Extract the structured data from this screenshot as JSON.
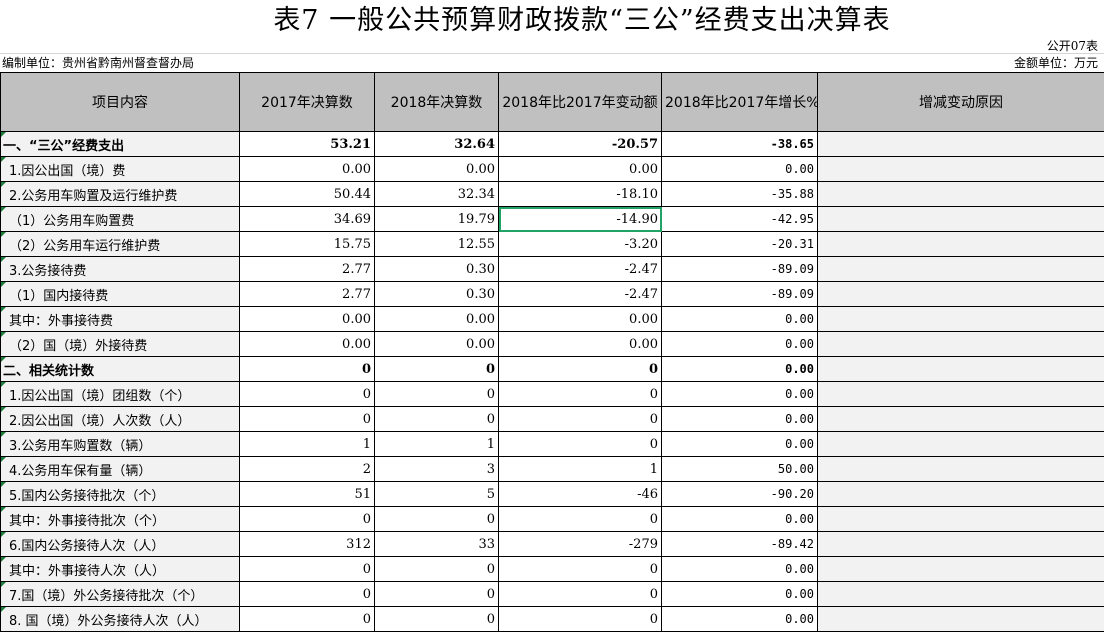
{
  "title": "表7  一般公共预算财政拨款“三公”经费支出决算表",
  "code": "公开07表",
  "unit_left": "编制单位：贵州省黔南州督查督办局",
  "unit_right": "金额单位：万元",
  "headers": [
    "项目内容",
    "2017年决算数",
    "2018年决算数",
    "2018年比2017年变动额",
    "2018年比2017年增长%",
    "增减变动原因"
  ],
  "rows": [
    {
      "name": "一、“三公”经费支出",
      "v2017": "53.21",
      "v2018": "32.64",
      "change": "-20.57",
      "pct": "-38.65",
      "reason": ""
    },
    {
      "name": "1.因公出国（境）费",
      "v2017": "0.00",
      "v2018": "0.00",
      "change": "0.00",
      "pct": "0.00",
      "reason": ""
    },
    {
      "name": "2.公务用车购置及运行维护费",
      "v2017": "50.44",
      "v2018": "32.34",
      "change": "-18.10",
      "pct": "-35.88",
      "reason": ""
    },
    {
      "name": "（1）公务用车购置费",
      "v2017": "34.69",
      "v2018": "19.79",
      "change": "-14.90",
      "pct": "-42.95",
      "reason": ""
    },
    {
      "name": "（2）公务用车运行维护费",
      "v2017": "15.75",
      "v2018": "12.55",
      "change": "-3.20",
      "pct": "-20.31",
      "reason": ""
    },
    {
      "name": "3.公务接待费",
      "v2017": "2.77",
      "v2018": "0.30",
      "change": "-2.47",
      "pct": "-89.09",
      "reason": ""
    },
    {
      "name": "（1）国内接待费",
      "v2017": "2.77",
      "v2018": "0.30",
      "change": "-2.47",
      "pct": "-89.09",
      "reason": ""
    },
    {
      "name": "其中：外事接待费",
      "v2017": "0.00",
      "v2018": "0.00",
      "change": "0.00",
      "pct": "0.00",
      "reason": ""
    },
    {
      "name": "（2）国（境）外接待费",
      "v2017": "0.00",
      "v2018": "0.00",
      "change": "0.00",
      "pct": "0.00",
      "reason": ""
    },
    {
      "name": "二、相关统计数",
      "v2017": "0",
      "v2018": "0",
      "change": "0",
      "pct": "0.00",
      "reason": ""
    },
    {
      "name": "1.因公出国（境）团组数（个）",
      "v2017": "0",
      "v2018": "0",
      "change": "0",
      "pct": "0.00",
      "reason": ""
    },
    {
      "name": "2.因公出国（境）人次数（人）",
      "v2017": "0",
      "v2018": "0",
      "change": "0",
      "pct": "0.00",
      "reason": ""
    },
    {
      "name": "3.公务用车购置数（辆）",
      "v2017": "1",
      "v2018": "1",
      "change": "0",
      "pct": "0.00",
      "reason": ""
    },
    {
      "name": "4.公务用车保有量（辆）",
      "v2017": "2",
      "v2018": "3",
      "change": "1",
      "pct": "50.00",
      "reason": ""
    },
    {
      "name": "5.国内公务接待批次（个）",
      "v2017": "51",
      "v2018": "5",
      "change": "-46",
      "pct": "-90.20",
      "reason": ""
    },
    {
      "name": "其中：外事接待批次（个）",
      "v2017": "0",
      "v2018": "0",
      "change": "0",
      "pct": "0.00",
      "reason": ""
    },
    {
      "name": "6.国内公务接待人次（人）",
      "v2017": "312",
      "v2018": "33",
      "change": "-279",
      "pct": "-89.42",
      "reason": ""
    },
    {
      "name": "其中：外事接待人次（人）",
      "v2017": "0",
      "v2018": "0",
      "change": "0",
      "pct": "0.00",
      "reason": ""
    },
    {
      "name": "7.国（境）外公务接待批次（个）",
      "v2017": "0",
      "v2018": "0",
      "change": "0",
      "pct": "0.00",
      "reason": ""
    },
    {
      "name": "8. 国（境）外公务接待人次（人）",
      "v2017": "0",
      "v2018": "0",
      "change": "0",
      "pct": "0.00",
      "reason": ""
    }
  ],
  "selected_cell": {
    "row": 3,
    "column": "change"
  }
}
